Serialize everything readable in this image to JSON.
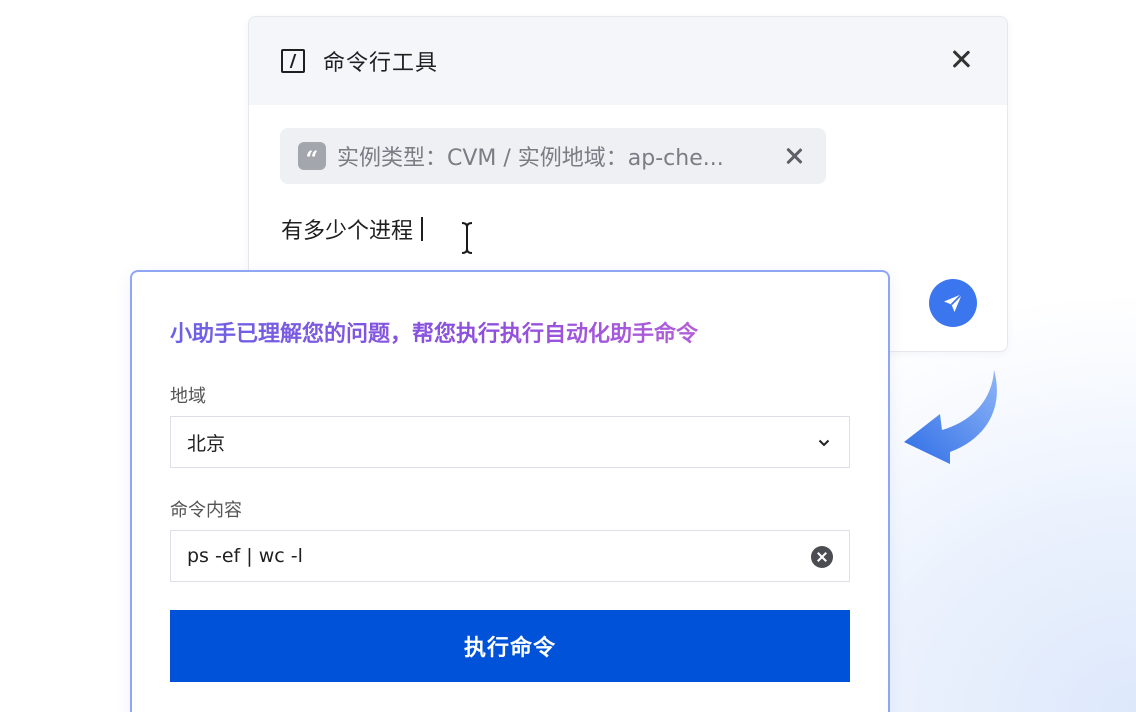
{
  "terminal": {
    "title": "命令行工具",
    "context_chip": "实例类型：CVM / 实例地域：ap-che...",
    "query": "有多少个进程"
  },
  "assistant": {
    "message": "小助手已理解您的问题，帮您执行执行自动化助手命令",
    "region_label": "地域",
    "region_value": "北京",
    "command_label": "命令内容",
    "command_value": "ps -ef | wc -l",
    "execute_label": "执行命令"
  },
  "icons": {
    "terminal": "terminal-icon",
    "close": "close-icon",
    "quote": "quote-icon",
    "send": "send-icon",
    "chevron": "chevron-down-icon",
    "clear": "clear-icon",
    "arrow": "curved-arrow-icon"
  },
  "colors": {
    "primary": "#0052d9",
    "send": "#3b76ee",
    "accent_border": "#8fa6f5",
    "message_gradient_start": "#6b62e6",
    "message_gradient_end": "#b35ed8"
  }
}
